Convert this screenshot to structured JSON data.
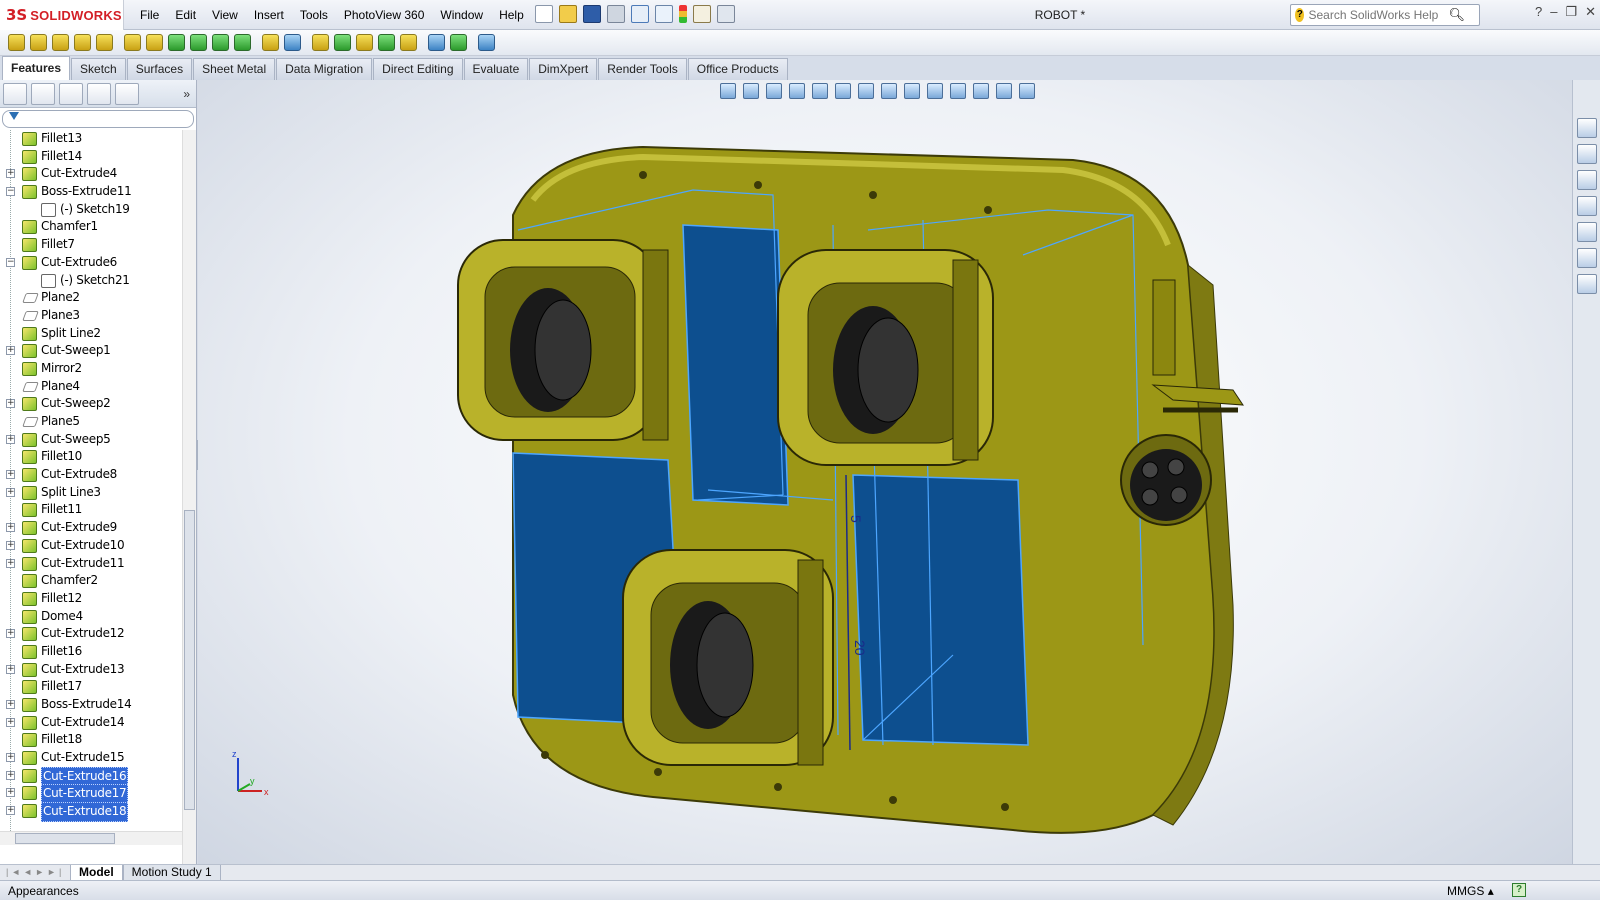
{
  "app": {
    "brand_symbol": "3S",
    "brand": "SOLIDWORKS",
    "doc_title": "ROBOT *"
  },
  "menu": [
    "File",
    "Edit",
    "View",
    "Insert",
    "Tools",
    "PhotoView 360",
    "Window",
    "Help"
  ],
  "search": {
    "placeholder": "Search SolidWorks Help"
  },
  "tabs": [
    "Features",
    "Sketch",
    "Surfaces",
    "Sheet Metal",
    "Data Migration",
    "Direct Editing",
    "Evaluate",
    "DimXpert",
    "Render Tools",
    "Office Products"
  ],
  "tree": [
    {
      "label": "Fillet13",
      "exp": false,
      "icon": "fillet-icon"
    },
    {
      "label": "Fillet14",
      "exp": false,
      "icon": "fillet-icon"
    },
    {
      "label": "Cut-Extrude4",
      "exp": true,
      "icon": "cut-extrude-icon"
    },
    {
      "label": "Boss-Extrude11",
      "exp": true,
      "icon": "boss-extrude-icon",
      "expanded": true
    },
    {
      "label": "(-) Sketch19",
      "exp": false,
      "icon": "sketch-icon",
      "child": true
    },
    {
      "label": "Chamfer1",
      "exp": false,
      "icon": "chamfer-icon"
    },
    {
      "label": "Fillet7",
      "exp": false,
      "icon": "fillet-icon"
    },
    {
      "label": "Cut-Extrude6",
      "exp": true,
      "icon": "cut-extrude-icon",
      "expanded": true
    },
    {
      "label": "(-) Sketch21",
      "exp": false,
      "icon": "sketch-icon",
      "child": true
    },
    {
      "label": "Plane2",
      "exp": false,
      "icon": "plane-icon"
    },
    {
      "label": "Plane3",
      "exp": false,
      "icon": "plane-icon"
    },
    {
      "label": "Split Line2",
      "exp": false,
      "icon": "split-line-icon"
    },
    {
      "label": "Cut-Sweep1",
      "exp": true,
      "icon": "cut-sweep-icon"
    },
    {
      "label": "Mirror2",
      "exp": false,
      "icon": "mirror-icon"
    },
    {
      "label": "Plane4",
      "exp": false,
      "icon": "plane-icon"
    },
    {
      "label": "Cut-Sweep2",
      "exp": true,
      "icon": "cut-sweep-icon"
    },
    {
      "label": "Plane5",
      "exp": false,
      "icon": "plane-icon"
    },
    {
      "label": "Cut-Sweep5",
      "exp": true,
      "icon": "cut-sweep-icon"
    },
    {
      "label": "Fillet10",
      "exp": false,
      "icon": "fillet-icon"
    },
    {
      "label": "Cut-Extrude8",
      "exp": true,
      "icon": "cut-extrude-icon"
    },
    {
      "label": "Split Line3",
      "exp": true,
      "icon": "split-line-icon"
    },
    {
      "label": "Fillet11",
      "exp": false,
      "icon": "fillet-icon"
    },
    {
      "label": "Cut-Extrude9",
      "exp": true,
      "icon": "cut-extrude-icon"
    },
    {
      "label": "Cut-Extrude10",
      "exp": true,
      "icon": "cut-extrude-icon"
    },
    {
      "label": "Cut-Extrude11",
      "exp": true,
      "icon": "cut-extrude-icon"
    },
    {
      "label": "Chamfer2",
      "exp": false,
      "icon": "chamfer-icon"
    },
    {
      "label": "Fillet12",
      "exp": false,
      "icon": "fillet-icon"
    },
    {
      "label": "Dome4",
      "exp": false,
      "icon": "dome-icon"
    },
    {
      "label": "Cut-Extrude12",
      "exp": true,
      "icon": "cut-extrude-icon"
    },
    {
      "label": "Fillet16",
      "exp": false,
      "icon": "fillet-icon"
    },
    {
      "label": "Cut-Extrude13",
      "exp": true,
      "icon": "cut-extrude-icon"
    },
    {
      "label": "Fillet17",
      "exp": false,
      "icon": "fillet-icon"
    },
    {
      "label": "Boss-Extrude14",
      "exp": true,
      "icon": "boss-extrude-icon"
    },
    {
      "label": "Cut-Extrude14",
      "exp": true,
      "icon": "cut-extrude-icon"
    },
    {
      "label": "Fillet18",
      "exp": false,
      "icon": "fillet-icon"
    },
    {
      "label": "Cut-Extrude15",
      "exp": true,
      "icon": "cut-extrude-icon"
    },
    {
      "label": "Cut-Extrude16",
      "exp": true,
      "icon": "cut-extrude-icon",
      "selected": true
    },
    {
      "label": "Cut-Extrude17",
      "exp": true,
      "icon": "cut-extrude-icon",
      "selected": true
    },
    {
      "label": "Cut-Extrude18",
      "exp": true,
      "icon": "cut-extrude-icon",
      "selected": true
    }
  ],
  "viewport": {
    "dimensions": [
      "5",
      "20"
    ],
    "triad": {
      "x": "x",
      "y": "y",
      "z": "z"
    }
  },
  "bottom_tabs": [
    "Model",
    "Motion Study 1"
  ],
  "status": {
    "text": "Appearances",
    "units": "MMGS",
    "units_caret": "▴",
    "help": "?"
  },
  "colors": {
    "model_body": "#9c9716",
    "model_highlight": "#d6d04a",
    "cut_fill": "#0d4f8f",
    "selection": "#3168d6",
    "edge_blue": "#4da6ff"
  }
}
